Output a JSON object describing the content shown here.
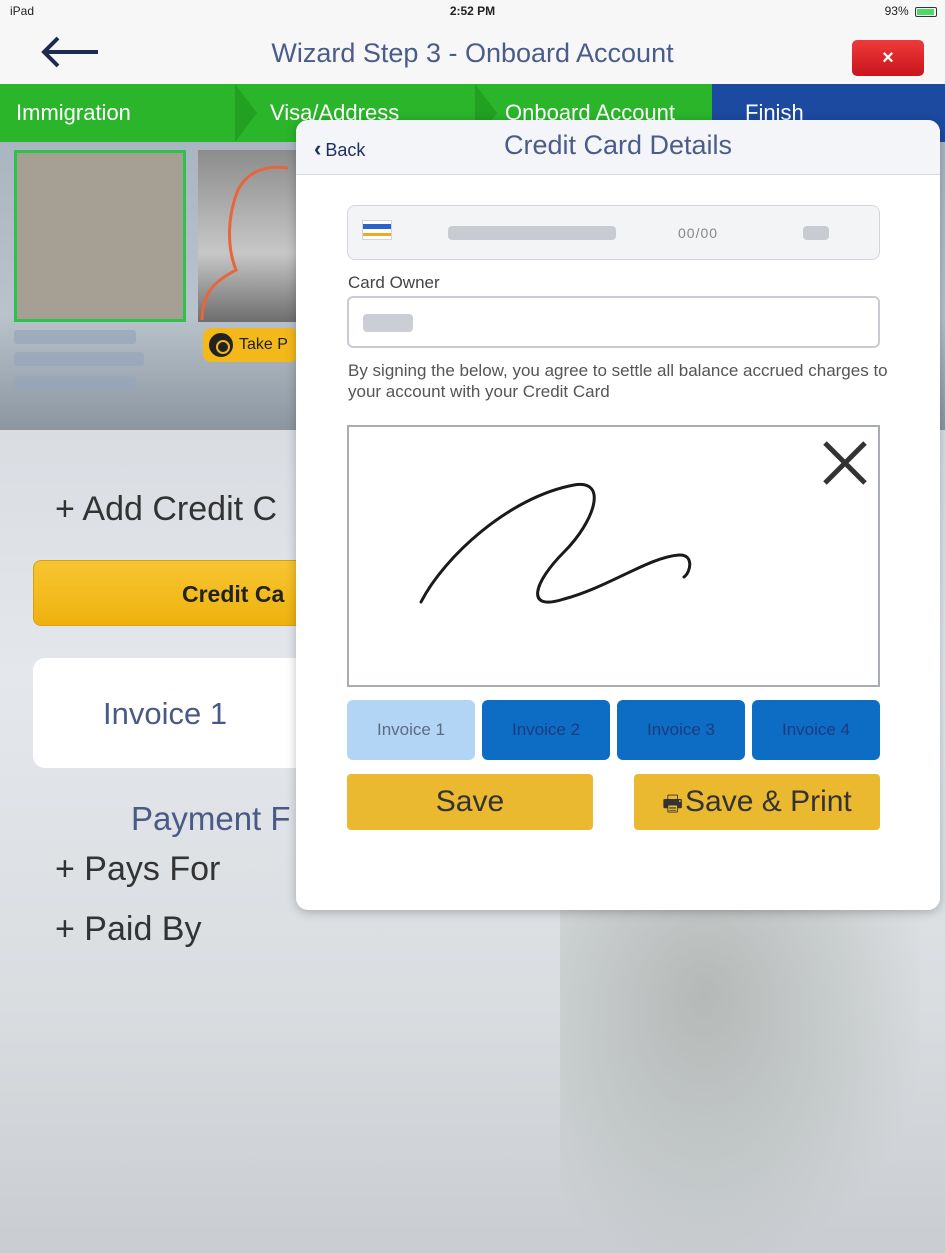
{
  "status_bar": {
    "device": "iPad",
    "time": "2:52 PM",
    "battery": "93%"
  },
  "header": {
    "back_icon": "arrow-left-icon",
    "title": "Wizard Step 3 - Onboard Account",
    "close_label": "×"
  },
  "steps": [
    "Immigration",
    "Visa/Address",
    "Onboard Account",
    "Finish"
  ],
  "photo_strip": {
    "take_photo_label": "Take P"
  },
  "background": {
    "add_credit_label": "+ Add Credit C",
    "credit_card_bar_label": "Credit Ca",
    "invoice_card_label": "Invoice 1",
    "payment_label": "Payment F",
    "pays_for_label": "+ Pays For",
    "paid_by_label": "+ Paid By"
  },
  "modal": {
    "back_label": "Back",
    "title": "Credit Card Details",
    "card_expiry_masked": "00/00",
    "card_owner_label": "Card Owner",
    "agreement_text": "By signing the below, you agree to settle all balance accrued charges to your account with your Credit Card",
    "invoice_tabs": [
      "Invoice 1",
      "Invoice 2",
      "Invoice 3",
      "Invoice 4"
    ],
    "save_label": "Save",
    "save_print_label": "Save & Print"
  },
  "colors": {
    "step_green": "#2bb52b",
    "step_blue": "#1b4aa0",
    "accent_yellow": "#eab92f",
    "close_red": "#d9232a",
    "tab_active": "#b3d5f5",
    "tab_idle": "#0d6cc3"
  }
}
